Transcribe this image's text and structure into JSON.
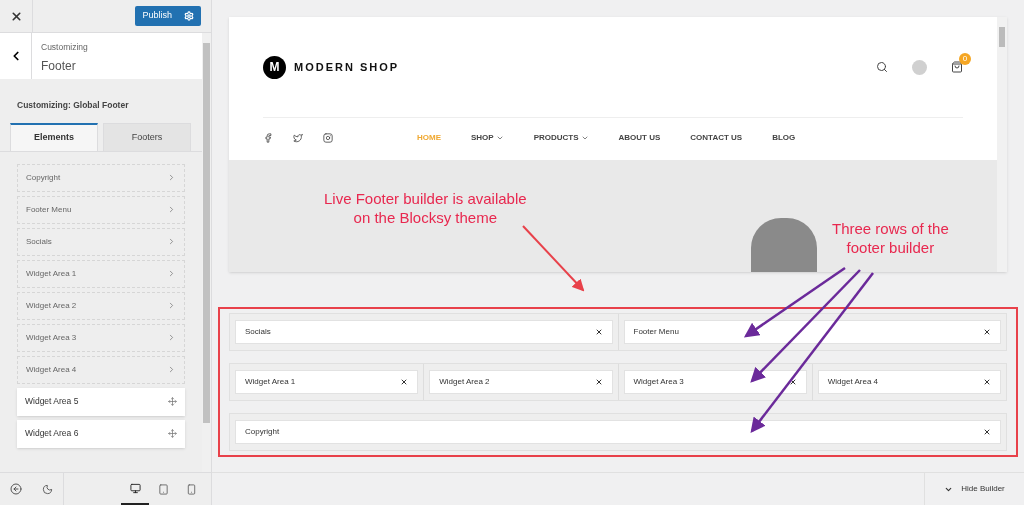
{
  "header": {
    "publish": "Publish"
  },
  "section": {
    "overline": "Customizing",
    "title": "Footer"
  },
  "panel_title": "Customizing: Global Footer",
  "tabs": [
    {
      "label": "Elements",
      "selected": true
    },
    {
      "label": "Footers",
      "selected": false
    }
  ],
  "elements": [
    {
      "label": "Copyright",
      "kind": "placed"
    },
    {
      "label": "Footer Menu",
      "kind": "placed"
    },
    {
      "label": "Socials",
      "kind": "placed"
    },
    {
      "label": "Widget Area 1",
      "kind": "placed"
    },
    {
      "label": "Widget Area 2",
      "kind": "placed"
    },
    {
      "label": "Widget Area 3",
      "kind": "placed"
    },
    {
      "label": "Widget Area 4",
      "kind": "placed"
    },
    {
      "label": "Widget Area 5",
      "kind": "available"
    },
    {
      "label": "Widget Area 6",
      "kind": "available"
    }
  ],
  "devices": [
    {
      "kind": "desktop",
      "selected": true
    },
    {
      "kind": "tablet",
      "selected": false
    },
    {
      "kind": "mobile",
      "selected": false
    }
  ],
  "preview": {
    "logo_letter": "M",
    "site_name": "MODERN SHOP",
    "cart_count": "0",
    "menu": [
      {
        "label": "HOME",
        "selected": true,
        "dropdown": false
      },
      {
        "label": "SHOP",
        "selected": false,
        "dropdown": true
      },
      {
        "label": "PRODUCTS",
        "selected": false,
        "dropdown": true
      },
      {
        "label": "ABOUT US",
        "selected": false,
        "dropdown": false
      },
      {
        "label": "CONTACT US",
        "selected": false,
        "dropdown": false
      },
      {
        "label": "BLOG",
        "selected": false,
        "dropdown": false
      }
    ]
  },
  "annotations": [
    {
      "lines": [
        "Live Footer builder is available",
        "on the Blocksy theme"
      ]
    },
    {
      "lines": [
        "Three rows of the",
        "footer builder"
      ]
    }
  ],
  "builder": {
    "rows": [
      {
        "items": [
          "Socials",
          "Footer Menu"
        ]
      },
      {
        "items": [
          "Widget Area 1",
          "Widget Area 2",
          "Widget Area 3",
          "Widget Area 4"
        ]
      },
      {
        "items": [
          "Copyright"
        ]
      }
    ]
  },
  "hide_builder": "Hide Builder"
}
